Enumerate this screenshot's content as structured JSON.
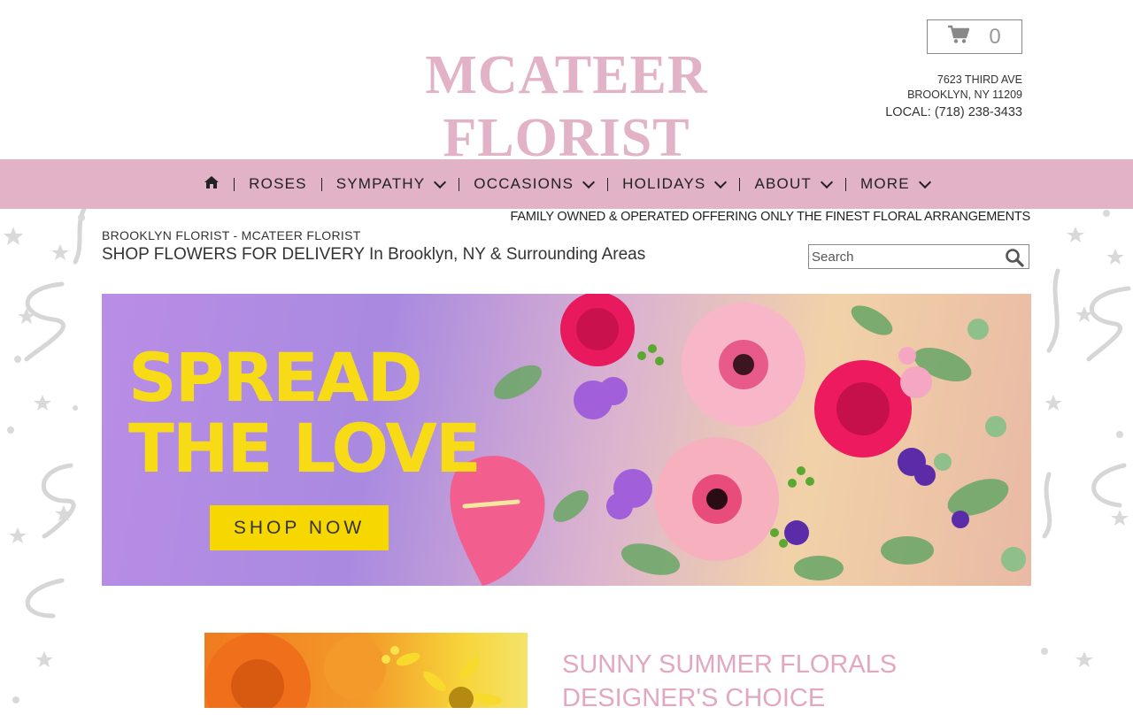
{
  "header": {
    "logo": "MCATEER FLORIST",
    "cart_count": "0",
    "address_line1": "7623 THIRD AVE",
    "address_line2": "BROOKLYN, NY 11209",
    "phone": "LOCAL: (718) 238-3433"
  },
  "nav": {
    "items": [
      {
        "label": "ROSES",
        "has_dropdown": false
      },
      {
        "label": "SYMPATHY",
        "has_dropdown": true
      },
      {
        "label": "OCCASIONS",
        "has_dropdown": true
      },
      {
        "label": "HOLIDAYS",
        "has_dropdown": true
      },
      {
        "label": "ABOUT",
        "has_dropdown": true
      },
      {
        "label": "MORE",
        "has_dropdown": true
      }
    ]
  },
  "main": {
    "tagline": "FAMILY OWNED & OPERATED OFFERING ONLY THE FINEST FLORAL ARRANGEMENTS",
    "breadcrumb": "BROOKLYN FLORIST - MCATEER FLORIST",
    "headline": "SHOP FLOWERS FOR DELIVERY In Brooklyn, NY & Surrounding Areas",
    "search_placeholder": "Search"
  },
  "banner": {
    "line1": "SPREAD",
    "line2": "THE LOVE",
    "button": "SHOP NOW"
  },
  "product": {
    "title_line1": "SUNNY SUMMER FLORALS",
    "title_line2": "DESIGNER'S CHOICE"
  },
  "colors": {
    "brand_pink": "#e2b2c6",
    "banner_yellow": "#f6db16",
    "button_yellow": "#f6d700"
  }
}
